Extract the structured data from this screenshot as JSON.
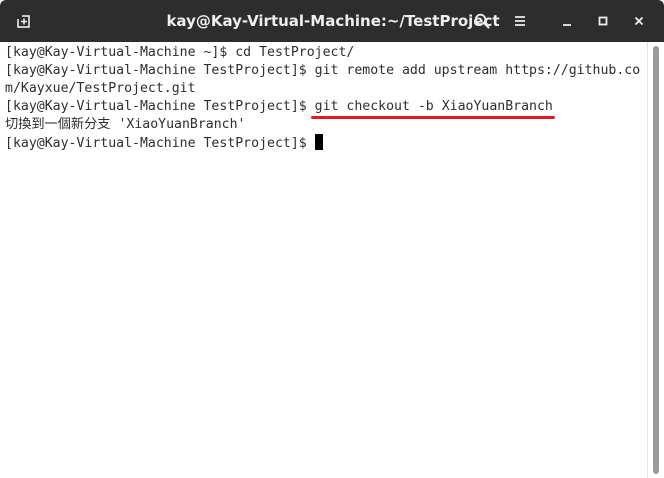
{
  "window": {
    "title": "kay@Kay-Virtual-Machine:~/TestProject"
  },
  "titlebar": {
    "icons": [
      "new-tab-icon",
      "search-icon",
      "hamburger-menu-icon",
      "minimize-icon",
      "maximize-icon",
      "close-icon"
    ]
  },
  "terminal": {
    "line1": "[kay@Kay-Virtual-Machine ~]$ cd TestProject/",
    "line2": "[kay@Kay-Virtual-Machine TestProject]$ git remote add upstream https://github.co",
    "line3": "m/Kayxue/TestProject.git",
    "line4_prompt": "[kay@Kay-Virtual-Machine TestProject]$ ",
    "line4_command": "git checkout -b XiaoYuanBranch",
    "line5": "切換到一個新分支 'XiaoYuanBranch'",
    "line6_prompt": "[kay@Kay-Virtual-Machine TestProject]$ "
  },
  "colors": {
    "titlebar_bg": "#2d2d2d",
    "title_text": "#eeeeee",
    "terminal_bg": "#ffffff",
    "terminal_text": "#2e2e2e",
    "annotation_underline": "#e01b24"
  }
}
